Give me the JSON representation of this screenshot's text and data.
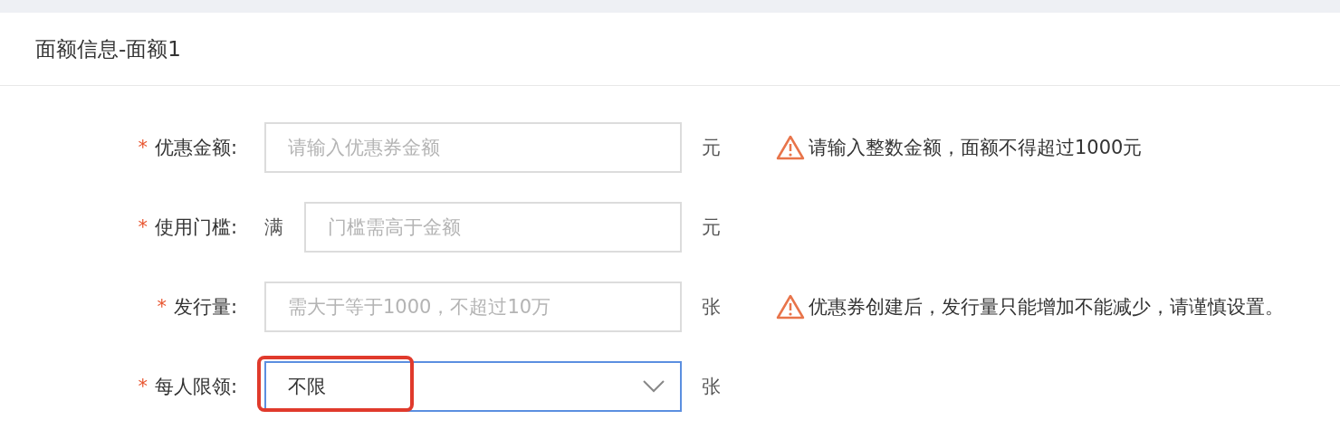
{
  "section": {
    "title": "面额信息-面额1"
  },
  "fields": [
    {
      "kind": "input",
      "required_mark": "*",
      "label": "优惠金额:",
      "placeholder": "请输入优惠券金额",
      "unit": "元",
      "warning": "请输入整数金额，面额不得超过1000元"
    },
    {
      "kind": "input",
      "required_mark": "*",
      "label": "使用门槛:",
      "prefix": "满",
      "placeholder": "门槛需高于金额",
      "unit": "元"
    },
    {
      "kind": "input",
      "required_mark": "*",
      "label": "发行量:",
      "placeholder": "需大于等于1000，不超过10万",
      "unit": "张",
      "warning": "优惠券创建后，发行量只能增加不能减少，请谨慎设置。"
    },
    {
      "kind": "select",
      "required_mark": "*",
      "label": "每人限领:",
      "value": "不限",
      "focused": true,
      "highlighted": true,
      "unit": "张"
    }
  ]
}
